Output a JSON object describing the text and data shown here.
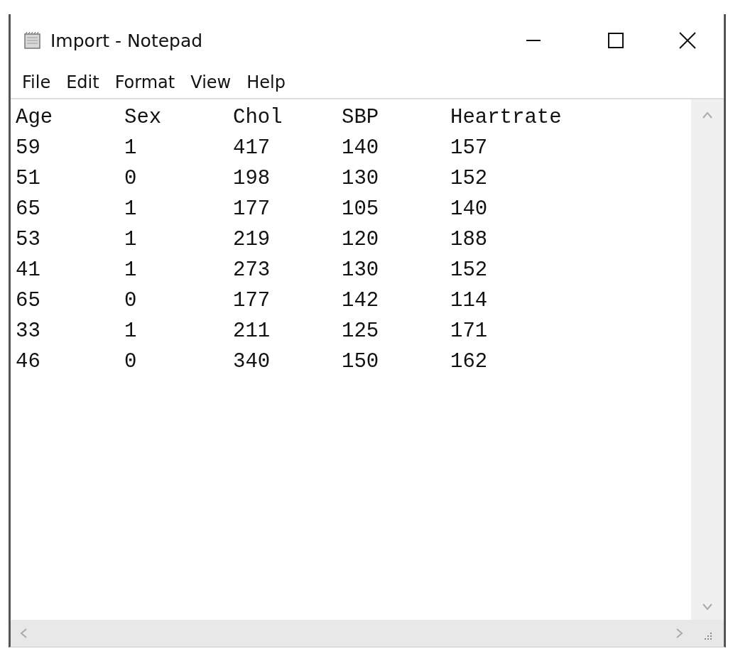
{
  "window": {
    "title": "Import - Notepad"
  },
  "menu": [
    "File",
    "Edit",
    "Format",
    "View",
    "Help"
  ],
  "text_area": {
    "columns": [
      "Age",
      "Sex",
      "Chol",
      "SBP",
      "Heartrate"
    ],
    "rows": [
      [
        "59",
        "1",
        "417",
        "140",
        "157"
      ],
      [
        "51",
        "0",
        "198",
        "130",
        "152"
      ],
      [
        "65",
        "1",
        "177",
        "105",
        "140"
      ],
      [
        "53",
        "1",
        "219",
        "120",
        "188"
      ],
      [
        "41",
        "1",
        "273",
        "130",
        "152"
      ],
      [
        "65",
        "0",
        "177",
        "142",
        "114"
      ],
      [
        "33",
        "1",
        "211",
        "125",
        "171"
      ],
      [
        "46",
        "0",
        "340",
        "150",
        "162"
      ]
    ]
  }
}
